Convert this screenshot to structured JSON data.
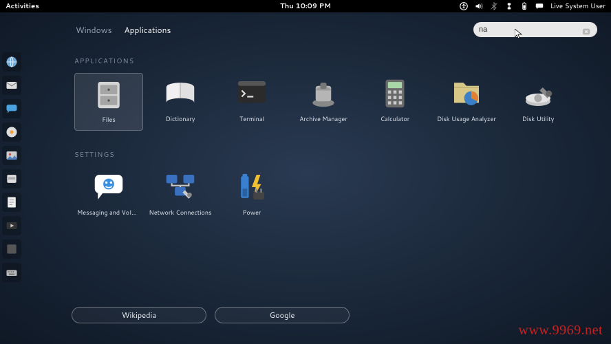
{
  "topbar": {
    "activities": "Activities",
    "clock": "Thu 10:09 PM",
    "user_label": "Live System User"
  },
  "tabs": {
    "windows": "Windows",
    "applications": "Applications",
    "active": "applications"
  },
  "search": {
    "value": "na",
    "placeholder": ""
  },
  "sections": {
    "applications_label": "APPLICATIONS",
    "settings_label": "SETTINGS"
  },
  "apps": [
    {
      "id": "files",
      "label": "Files",
      "selected": true
    },
    {
      "id": "dictionary",
      "label": "Dictionary",
      "selected": false
    },
    {
      "id": "terminal",
      "label": "Terminal",
      "selected": false
    },
    {
      "id": "archive-manager",
      "label": "Archive Manager",
      "selected": false
    },
    {
      "id": "calculator",
      "label": "Calculator",
      "selected": false
    },
    {
      "id": "disk-usage-analyzer",
      "label": "Disk Usage Analyzer",
      "selected": false
    },
    {
      "id": "disk-utility",
      "label": "Disk Utility",
      "selected": false
    }
  ],
  "settings": [
    {
      "id": "messaging",
      "label": "Messaging and VoIP A…"
    },
    {
      "id": "network",
      "label": "Network Connections"
    },
    {
      "id": "power",
      "label": "Power"
    }
  ],
  "providers": {
    "wikipedia": "Wikipedia",
    "google": "Google"
  },
  "watermark": "www.9969.net"
}
